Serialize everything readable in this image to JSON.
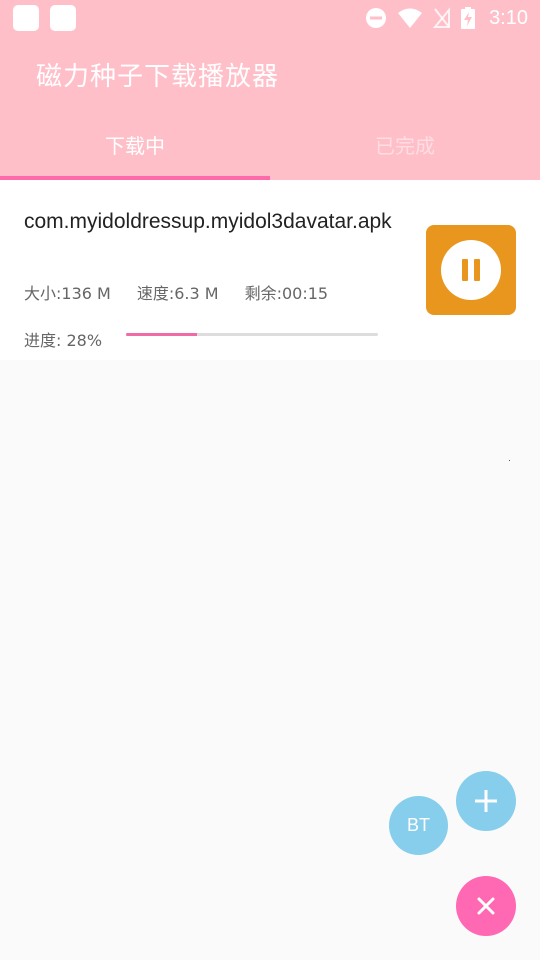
{
  "status_bar": {
    "time": "3:10",
    "icons": [
      "app-square-icon",
      "app-square-icon",
      "do-not-disturb-icon",
      "wifi-icon",
      "no-signal-icon",
      "battery-charging-icon"
    ]
  },
  "app_bar": {
    "title": "磁力种子下载播放器",
    "background": "#ffbfc9"
  },
  "tabs": [
    {
      "label": "下载中",
      "selected": true
    },
    {
      "label": "已完成",
      "selected": false
    }
  ],
  "download_item": {
    "file_name": "com.myidoldressup.myidol3davatar.apk",
    "size": "大小:136 M",
    "speed": "速度:6.3 M",
    "remaining": "剩余:00:15",
    "progress_text": "进度: 28%",
    "progress": 0.28,
    "action_icon": "pause-icon",
    "action_color": "#e8961e"
  },
  "fabs": {
    "bt_label": "BT",
    "add_icon": "plus-icon",
    "close_icon": "close-icon",
    "blue": "#86ceeb",
    "pink": "#ff69b4"
  },
  "colors": {
    "accent": "#ff6aaa",
    "background": "#fafafa"
  }
}
